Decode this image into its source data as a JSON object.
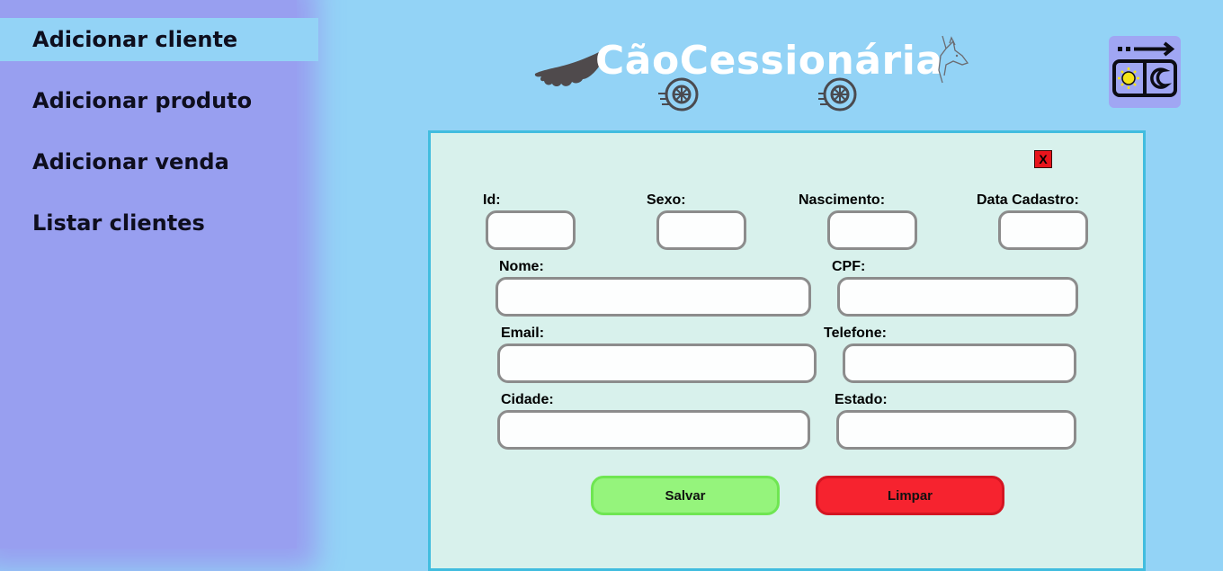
{
  "sidebar": {
    "items": [
      {
        "label": "Adicionar cliente",
        "active": true
      },
      {
        "label": "Adicionar produto",
        "active": false
      },
      {
        "label": "Adicionar venda",
        "active": false
      },
      {
        "label": "Listar clientes",
        "active": false
      }
    ]
  },
  "header": {
    "logo_text": "CãoCessionária",
    "icons": [
      "tail-icon",
      "wheel-icon",
      "wheel-icon",
      "dog-head-icon"
    ]
  },
  "theme_toggle": {
    "icons": [
      "arrow-right-icon",
      "sun-icon",
      "moon-icon"
    ]
  },
  "form": {
    "close_label": "X",
    "fields": {
      "id": {
        "label": "Id:",
        "value": ""
      },
      "sexo": {
        "label": "Sexo:",
        "value": ""
      },
      "nascimento": {
        "label": "Nascimento:",
        "value": ""
      },
      "data_cadastro": {
        "label": "Data Cadastro:",
        "value": ""
      },
      "nome": {
        "label": "Nome:",
        "value": ""
      },
      "cpf": {
        "label": "CPF:",
        "value": ""
      },
      "email": {
        "label": "Email:",
        "value": ""
      },
      "telefone": {
        "label": "Telefone:",
        "value": ""
      },
      "cidade": {
        "label": "Cidade:",
        "value": ""
      },
      "estado": {
        "label": "Estado:",
        "value": ""
      }
    },
    "save_label": "Salvar",
    "clear_label": "Limpar"
  },
  "colors": {
    "background": "#93d3f6",
    "sidebar": "#989ff0",
    "panel": "#d8f1ec",
    "panel_border": "#41bddf",
    "save": "#95f47c",
    "clear": "#f6232f",
    "close": "#e8141c"
  }
}
